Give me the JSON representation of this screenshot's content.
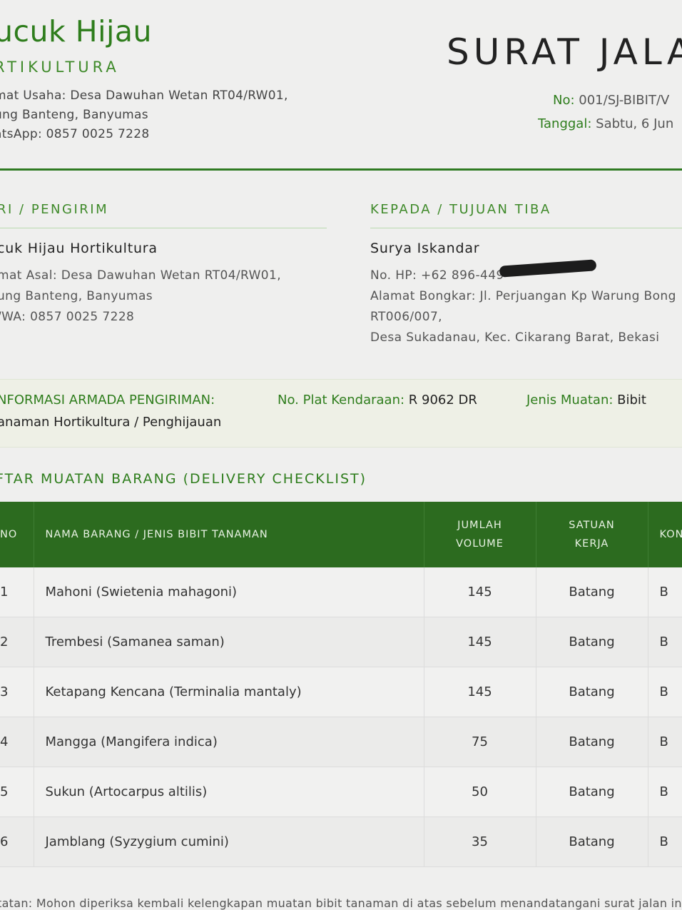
{
  "brand": {
    "name": "ucuk Hijau",
    "sub": "RTIKULTURA",
    "address_lines": [
      "mat Usaha: Desa Dawuhan Wetan RT04/RW01,",
      "ung Banteng, Banyumas",
      "atsApp: 0857 0025 7228"
    ]
  },
  "doc": {
    "title": "SURAT JALA",
    "no_label": "No:",
    "no_value": "001/SJ-BIBIT/V",
    "date_label": "Tanggal:",
    "date_value": "Sabtu, 6 Jun"
  },
  "sender": {
    "title": "RI / PENGIRIM",
    "name": "cuk Hijau Hortikultura",
    "lines": [
      "mat Asal: Desa Dawuhan Wetan RT04/RW01,",
      "ung Banteng, Banyumas",
      "/WA: 0857 0025 7228"
    ]
  },
  "recipient": {
    "title": "KEPADA / TUJUAN TIBA",
    "name": "Surya Iskandar",
    "phone": "No. HP: +62 896-449",
    "lines": [
      "Alamat Bongkar: Jl. Perjuangan Kp Warung Bong",
      "RT006/007,",
      "Desa Sukadanau, Kec. Cikarang Barat, Bekasi"
    ]
  },
  "armada": {
    "title": "NFORMASI ARMADA PENGIRIMAN:",
    "plate_label": "No. Plat Kendaraan:",
    "plate_value": "R 9062 DR",
    "cargo_label": "Jenis Muatan:",
    "cargo_value": "Bibit",
    "cargo_line2": "anaman Hortikultura / Penghijauan"
  },
  "list": {
    "title": "FTAR MUATAN BARANG (DELIVERY CHECKLIST)",
    "headers": {
      "no": "NO",
      "name": "NAMA BARANG / JENIS BIBIT TANAMAN",
      "vol1": "JUMLAH",
      "vol2": "VOLUME",
      "sat1": "SATUAN",
      "sat2": "KERJA",
      "kon": "KON"
    },
    "rows": [
      {
        "no": "1",
        "name": "Mahoni (Swietenia mahagoni)",
        "vol": "145",
        "unit": "Batang",
        "kon": "B"
      },
      {
        "no": "2",
        "name": "Trembesi (Samanea saman)",
        "vol": "145",
        "unit": "Batang",
        "kon": "B"
      },
      {
        "no": "3",
        "name": "Ketapang Kencana (Terminalia mantaly)",
        "vol": "145",
        "unit": "Batang",
        "kon": "B"
      },
      {
        "no": "4",
        "name": "Mangga (Mangifera indica)",
        "vol": "75",
        "unit": "Batang",
        "kon": "B"
      },
      {
        "no": "5",
        "name": "Sukun (Artocarpus altilis)",
        "vol": "50",
        "unit": "Batang",
        "kon": "B"
      },
      {
        "no": "6",
        "name": "Jamblang (Syzygium cumini)",
        "vol": "35",
        "unit": "Batang",
        "kon": "B"
      }
    ]
  },
  "note": "tatan: Mohon diperiksa kembali kelengkapan muatan bibit tanaman di atas sebelum menandatangani surat jalan ini se"
}
